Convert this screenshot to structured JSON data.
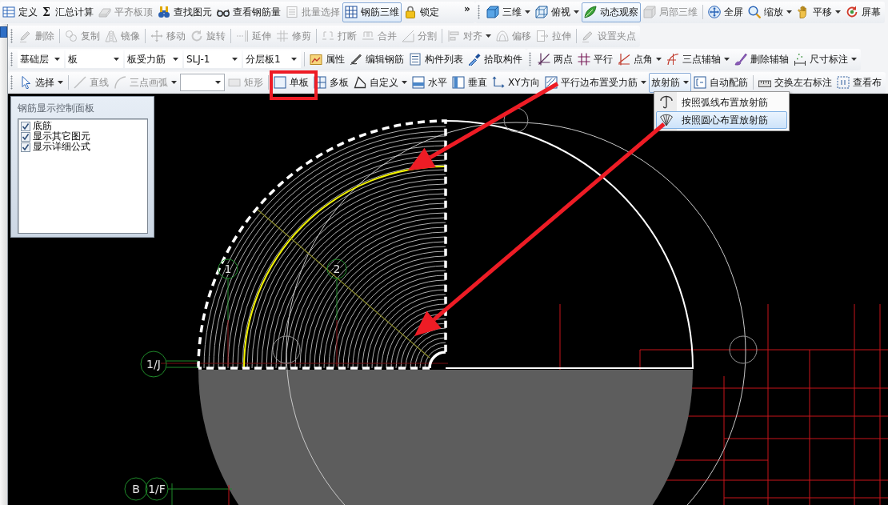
{
  "toolbar_rows": [
    {
      "toolbars": [
        {
          "groups": [
            {
              "items": [
                {
                  "kind": "button",
                  "label": "定义",
                  "disabled": false,
                  "pressed": false,
                  "dropdown": false
                },
                {
                  "kind": "button",
                  "symbol": "Σ",
                  "label": "汇总计算",
                  "disabled": false,
                  "pressed": false,
                  "dropdown": false
                },
                {
                  "kind": "button",
                  "label": "平齐板顶",
                  "disabled": true,
                  "pressed": false,
                  "dropdown": false
                },
                {
                  "kind": "button",
                  "label": "查找图元",
                  "disabled": false,
                  "pressed": false,
                  "dropdown": false
                },
                {
                  "kind": "button",
                  "label": "查看钢筋量",
                  "disabled": false,
                  "pressed": false,
                  "dropdown": false
                },
                {
                  "kind": "button",
                  "label": "批量选择",
                  "disabled": true,
                  "pressed": false,
                  "dropdown": false
                },
                {
                  "kind": "button",
                  "label": "钢筋三维",
                  "disabled": false,
                  "pressed": true,
                  "dropdown": false
                },
                {
                  "kind": "button",
                  "label": "锁定",
                  "disabled": false,
                  "pressed": false,
                  "dropdown": false
                },
                {
                  "kind": "overflow",
                  "symbol": "»"
                }
              ]
            }
          ]
        },
        {
          "groups": [
            {
              "items": [
                {
                  "kind": "button",
                  "label": "三维",
                  "disabled": false,
                  "pressed": false,
                  "dropdown": true
                },
                {
                  "kind": "button",
                  "label": "俯视",
                  "disabled": false,
                  "pressed": false,
                  "dropdown": true
                },
                {
                  "kind": "button",
                  "label": "动态观察",
                  "disabled": false,
                  "pressed": true,
                  "dropdown": false
                },
                {
                  "kind": "button",
                  "label": "局部三维",
                  "disabled": true,
                  "pressed": false,
                  "dropdown": false
                }
              ]
            },
            {
              "items": [
                {
                  "kind": "button",
                  "label": "全屏",
                  "disabled": false,
                  "pressed": false,
                  "dropdown": false
                },
                {
                  "kind": "button",
                  "label": "缩放",
                  "disabled": false,
                  "pressed": false,
                  "dropdown": true
                },
                {
                  "kind": "button",
                  "label": "平移",
                  "disabled": false,
                  "pressed": false,
                  "dropdown": true
                },
                {
                  "kind": "button",
                  "label": "屏幕",
                  "disabled": false,
                  "pressed": false,
                  "dropdown": false
                }
              ]
            }
          ]
        }
      ]
    },
    {
      "toolbars": [
        {
          "groups": [
            {
              "items": [
                {
                  "kind": "button",
                  "label": "删除",
                  "disabled": true,
                  "pressed": false,
                  "dropdown": false
                }
              ]
            },
            {
              "items": [
                {
                  "kind": "button",
                  "label": "复制",
                  "disabled": true,
                  "pressed": false,
                  "dropdown": false
                },
                {
                  "kind": "button",
                  "label": "镜像",
                  "disabled": true,
                  "pressed": false,
                  "dropdown": false
                }
              ]
            },
            {
              "items": [
                {
                  "kind": "button",
                  "label": "移动",
                  "disabled": true,
                  "pressed": false,
                  "dropdown": false
                },
                {
                  "kind": "button",
                  "label": "旋转",
                  "disabled": true,
                  "pressed": false,
                  "dropdown": false
                }
              ]
            },
            {
              "items": [
                {
                  "kind": "button",
                  "label": "延伸",
                  "disabled": true,
                  "pressed": false,
                  "dropdown": false
                },
                {
                  "kind": "button",
                  "label": "修剪",
                  "disabled": true,
                  "pressed": false,
                  "dropdown": false
                }
              ]
            },
            {
              "items": [
                {
                  "kind": "button",
                  "label": "打断",
                  "disabled": true,
                  "pressed": false,
                  "dropdown": false
                },
                {
                  "kind": "button",
                  "label": "合并",
                  "disabled": true,
                  "pressed": false,
                  "dropdown": false
                },
                {
                  "kind": "button",
                  "label": "分割",
                  "disabled": true,
                  "pressed": false,
                  "dropdown": false
                }
              ]
            },
            {
              "items": [
                {
                  "kind": "button",
                  "label": "对齐",
                  "disabled": true,
                  "pressed": false,
                  "dropdown": true
                },
                {
                  "kind": "button",
                  "label": "偏移",
                  "disabled": true,
                  "pressed": false,
                  "dropdown": false
                },
                {
                  "kind": "button",
                  "label": "拉伸",
                  "disabled": true,
                  "pressed": false,
                  "dropdown": false
                }
              ]
            },
            {
              "items": [
                {
                  "kind": "button",
                  "label": "设置夹点",
                  "disabled": true,
                  "pressed": false,
                  "dropdown": false
                }
              ]
            }
          ]
        }
      ]
    },
    {
      "toolbars": [
        {
          "groups": [
            {
              "items": [
                {
                  "kind": "combo",
                  "value": "基础层"
                },
                {
                  "kind": "combo",
                  "value": "板"
                },
                {
                  "kind": "combo",
                  "value": "板受力筋"
                },
                {
                  "kind": "combo",
                  "value": "SLJ-1"
                },
                {
                  "kind": "combo",
                  "value": "分层板1"
                }
              ]
            },
            {
              "items": [
                {
                  "kind": "button",
                  "label": "属性",
                  "disabled": false,
                  "pressed": false,
                  "dropdown": false
                },
                {
                  "kind": "button",
                  "label": "编辑钢筋",
                  "disabled": false,
                  "pressed": false,
                  "dropdown": false
                },
                {
                  "kind": "button",
                  "label": "构件列表",
                  "disabled": false,
                  "pressed": false,
                  "dropdown": false
                },
                {
                  "kind": "button",
                  "label": "拾取构件",
                  "disabled": false,
                  "pressed": false,
                  "dropdown": false
                }
              ]
            }
          ]
        },
        {
          "groups": [
            {
              "items": [
                {
                  "kind": "button",
                  "label": "两点",
                  "disabled": false,
                  "pressed": false,
                  "dropdown": false
                },
                {
                  "kind": "button",
                  "label": "平行",
                  "disabled": false,
                  "pressed": false,
                  "dropdown": false
                },
                {
                  "kind": "button",
                  "label": "点角",
                  "disabled": false,
                  "pressed": false,
                  "dropdown": true
                },
                {
                  "kind": "button",
                  "label": "三点辅轴",
                  "disabled": false,
                  "pressed": false,
                  "dropdown": true
                },
                {
                  "kind": "button",
                  "label": "删除辅轴",
                  "disabled": false,
                  "pressed": false,
                  "dropdown": false
                },
                {
                  "kind": "button",
                  "label": "尺寸标注",
                  "disabled": false,
                  "pressed": false,
                  "dropdown": true
                }
              ]
            }
          ]
        }
      ]
    },
    {
      "toolbars": [
        {
          "groups": [
            {
              "items": [
                {
                  "kind": "button",
                  "label": "选择",
                  "disabled": false,
                  "pressed": false,
                  "dropdown": true
                }
              ]
            },
            {
              "items": [
                {
                  "kind": "button",
                  "label": "直线",
                  "disabled": true,
                  "pressed": false,
                  "dropdown": false
                },
                {
                  "kind": "button",
                  "label": "三点画弧",
                  "disabled": true,
                  "pressed": false,
                  "dropdown": true
                },
                {
                  "kind": "combo"
                },
                {
                  "kind": "button",
                  "label": "矩形",
                  "disabled": true,
                  "pressed": false,
                  "dropdown": false
                }
              ]
            },
            {
              "items": [
                {
                  "kind": "button",
                  "label": "单板",
                  "disabled": false,
                  "pressed": false,
                  "dropdown": false
                },
                {
                  "kind": "button",
                  "label": "多板",
                  "disabled": false,
                  "pressed": false,
                  "dropdown": false
                },
                {
                  "kind": "button",
                  "label": "自定义",
                  "disabled": false,
                  "pressed": false,
                  "dropdown": true
                },
                {
                  "kind": "button",
                  "label": "水平",
                  "disabled": false,
                  "pressed": false,
                  "dropdown": false
                },
                {
                  "kind": "button",
                  "label": "垂直",
                  "disabled": false,
                  "pressed": false,
                  "dropdown": false
                },
                {
                  "kind": "button",
                  "label": "XY方向",
                  "disabled": false,
                  "pressed": false,
                  "dropdown": false
                },
                {
                  "kind": "button",
                  "label": "平行边布置受力筋",
                  "disabled": false,
                  "pressed": false,
                  "dropdown": true
                },
                {
                  "kind": "button",
                  "label": "放射筋",
                  "disabled": false,
                  "pressed": true,
                  "dropdown": true
                },
                {
                  "kind": "button",
                  "label": "自动配筋",
                  "disabled": false,
                  "pressed": false,
                  "dropdown": false
                }
              ]
            },
            {
              "items": [
                {
                  "kind": "button",
                  "label": "交换左右标注",
                  "disabled": false,
                  "pressed": false,
                  "dropdown": false
                },
                {
                  "kind": "button",
                  "label": "查看布",
                  "disabled": false,
                  "pressed": false,
                  "dropdown": false
                }
              ]
            }
          ]
        }
      ]
    }
  ],
  "radial_rebar_menu": {
    "items": [
      {
        "label": "按照弧线布置放射筋",
        "selected": false
      },
      {
        "label": "按照圆心布置放射筋",
        "selected": true
      }
    ]
  },
  "display_panel": {
    "title": "钢筋显示控制面板",
    "options": [
      {
        "label": "底筋",
        "checked": true
      },
      {
        "label": "显示其它图元",
        "checked": true
      },
      {
        "label": "显示详细公式",
        "checked": true
      }
    ]
  },
  "canvas": {
    "axis_markers": [
      {
        "label": "1"
      },
      {
        "label": "2"
      },
      {
        "label": "1/J"
      },
      {
        "label": "B"
      },
      {
        "label": "1/F"
      }
    ]
  }
}
